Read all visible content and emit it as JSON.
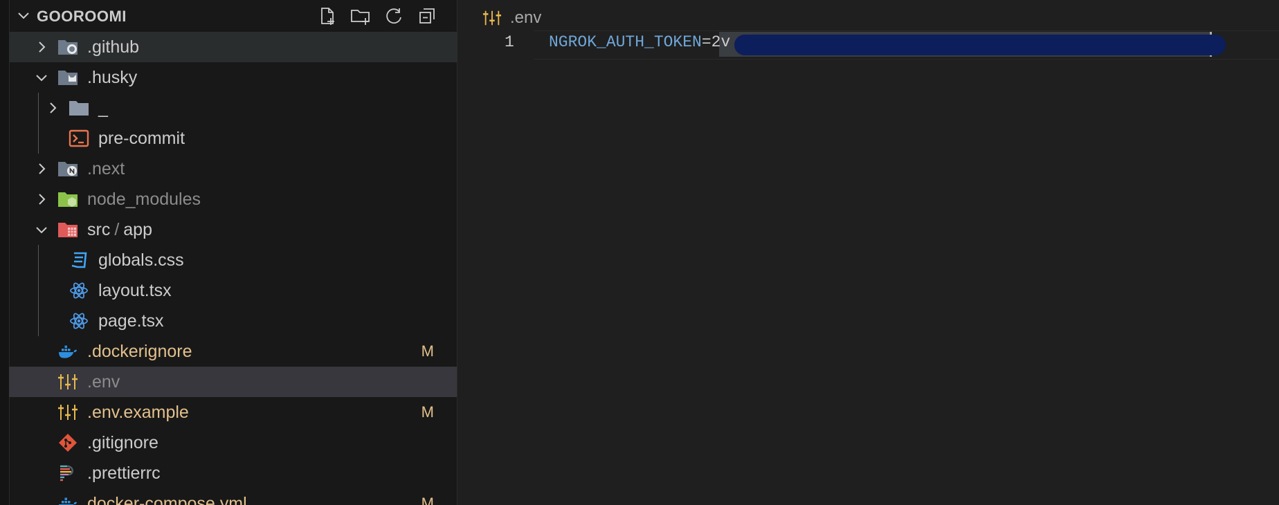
{
  "explorer": {
    "folder_title": "GOOROOMI",
    "actions": [
      {
        "name": "new-file-icon"
      },
      {
        "name": "new-folder-icon"
      },
      {
        "name": "refresh-icon"
      },
      {
        "name": "collapse-all-icon"
      }
    ],
    "items": [
      {
        "label": ".github",
        "type": "folder",
        "state": "collapsed",
        "color": "default"
      },
      {
        "label": ".husky",
        "type": "folder",
        "state": "expanded",
        "color": "default"
      },
      {
        "label": "_",
        "type": "folder",
        "state": "collapsed",
        "color": "default"
      },
      {
        "label": "pre-commit",
        "type": "file",
        "color": "default"
      },
      {
        "label": ".next",
        "type": "folder",
        "state": "collapsed",
        "color": "dim"
      },
      {
        "label": "node_modules",
        "type": "folder",
        "state": "collapsed",
        "color": "dim"
      },
      {
        "label_part1": "src",
        "label_sep": "/",
        "label_part2": "app",
        "type": "folder",
        "state": "expanded",
        "color": "default"
      },
      {
        "label": "globals.css",
        "type": "file",
        "color": "default"
      },
      {
        "label": "layout.tsx",
        "type": "file",
        "color": "default"
      },
      {
        "label": "page.tsx",
        "type": "file",
        "color": "default"
      },
      {
        "label": ".dockerignore",
        "type": "file",
        "color": "modified",
        "badge": "M"
      },
      {
        "label": ".env",
        "type": "file",
        "color": "dim"
      },
      {
        "label": ".env.example",
        "type": "file",
        "color": "modified",
        "badge": "M"
      },
      {
        "label": ".gitignore",
        "type": "file",
        "color": "default"
      },
      {
        "label": ".prettierrc",
        "type": "file",
        "color": "default"
      },
      {
        "label": "docker-compose.yml",
        "type": "file",
        "color": "modified",
        "badge": "M"
      }
    ]
  },
  "editor": {
    "breadcrumb_file": ".env",
    "lines": [
      {
        "number": "1",
        "key": "NGROK_AUTH_TOKEN",
        "op": "=",
        "value_visible": "2v"
      }
    ]
  },
  "colors": {
    "sidebar_bg": "#181818",
    "editor_bg": "#1f1f1f",
    "selected_row": "#37373d",
    "hover_row": "#2a2d2e",
    "modified": "#e2c08d",
    "env_key": "#6fa7d9",
    "redaction": "#0c1e5b"
  }
}
